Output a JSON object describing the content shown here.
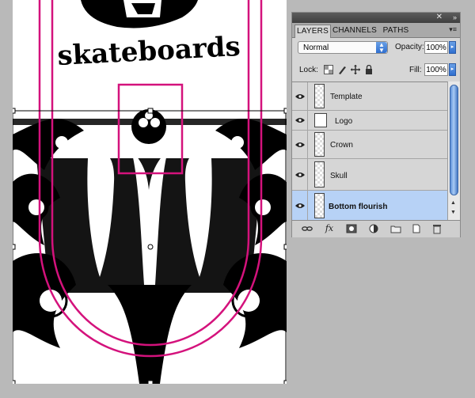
{
  "canvas": {
    "logo_text": "skateboards",
    "guide_color": "#d4127c"
  },
  "panel": {
    "tabs": [
      {
        "label": "LAYERS",
        "active": true
      },
      {
        "label": "CHANNELS",
        "active": false
      },
      {
        "label": "PATHS",
        "active": false
      }
    ],
    "menu_icon": "panel-menu-icon",
    "close_icon": "close-icon",
    "collapse_icon": "collapse-icon",
    "blend_mode": "Normal",
    "opacity_label": "Opacity:",
    "opacity_value": "100%",
    "lock_label": "Lock:",
    "fill_label": "Fill:",
    "fill_value": "100%",
    "lock_icons": [
      "lock-transparency-icon",
      "lock-paint-icon",
      "lock-position-icon",
      "lock-all-icon"
    ],
    "layers": [
      {
        "name": "Template",
        "visible": true,
        "selected": false
      },
      {
        "name": "Logo",
        "visible": true,
        "selected": false
      },
      {
        "name": "Crown",
        "visible": true,
        "selected": false
      },
      {
        "name": "Skull",
        "visible": true,
        "selected": false
      },
      {
        "name": "Bottom flourish",
        "visible": true,
        "selected": true
      }
    ],
    "footer_icons": [
      "link-layers-icon",
      "fx-icon",
      "layer-mask-icon",
      "adjustment-layer-icon",
      "group-folder-icon",
      "new-layer-icon",
      "trash-icon"
    ],
    "selection_color": "#b7d2f6"
  }
}
